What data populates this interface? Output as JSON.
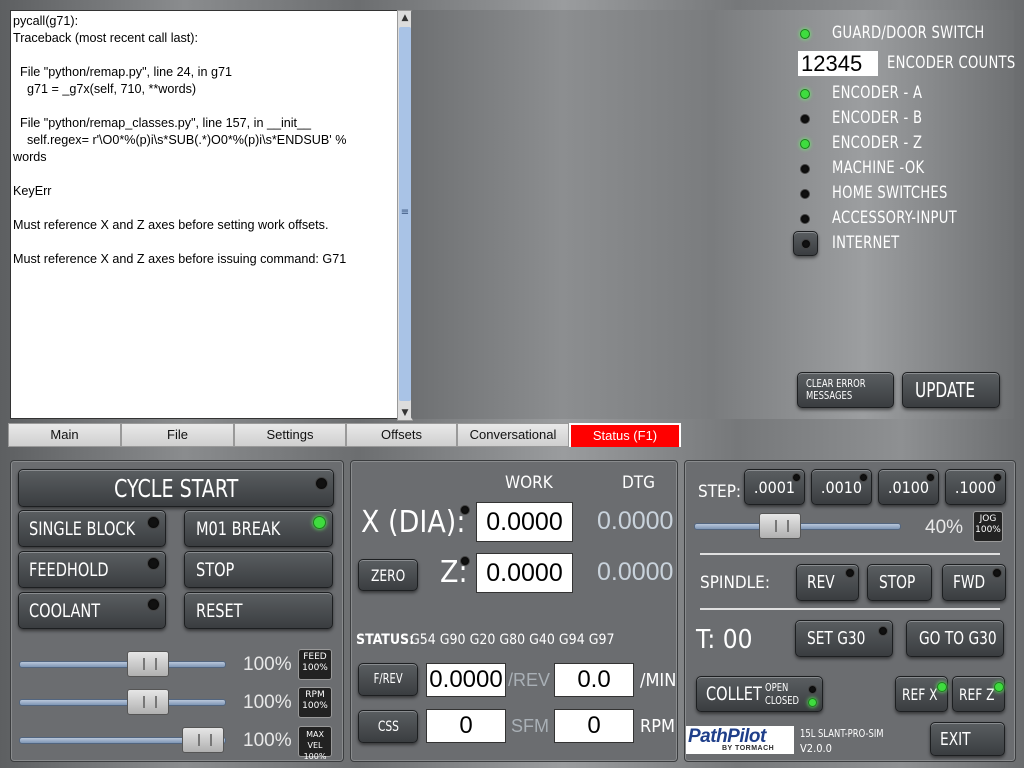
{
  "console": {
    "lines": [
      "pycall(g71):",
      "Traceback (most recent call last):",
      "",
      "  File \"python/remap.py\", line 24, in g71",
      "    g71 = _g7x(self, 710, **words)",
      "",
      "  File \"python/remap_classes.py\", line 157, in __init__",
      "    self.regex= r'\\O0*%(p)i\\s*SUB(.*)O0*%(p)i\\s*ENDSUB' %",
      "words",
      "",
      "KeyErr",
      "",
      "Must reference X and Z axes before setting work offsets.",
      "",
      "Must reference X and Z axes before issuing command: G71"
    ],
    "scroll_mid_glyph": "≡"
  },
  "status": {
    "guard_label": "GUARD/DOOR SWITCH",
    "encoder_counts_value": "12345",
    "encoder_counts_label": "ENCODER COUNTS",
    "encoder_a_label": "ENCODER - A",
    "encoder_b_label": "ENCODER - B",
    "encoder_z_label": "ENCODER - Z",
    "machine_ok_label": "MACHINE -OK",
    "home_switches_label": "HOME SWITCHES",
    "accessory_input_label": "ACCESSORY-INPUT",
    "internet_label": "INTERNET",
    "clear_error_line1": "CLEAR ERROR",
    "clear_error_line2": "MESSAGES",
    "update_label": "UPDATE"
  },
  "tabs": [
    "Main",
    "File",
    "Settings",
    "Offsets",
    "Conversational",
    "Status (F1)"
  ],
  "left_panel": {
    "cycle_start": "CYCLE START",
    "single_block": "SINGLE BLOCK",
    "m01_break": "M01 BREAK",
    "feedhold": "FEEDHOLD",
    "stop": "STOP",
    "coolant": "COOLANT",
    "reset": "RESET",
    "feed_pct": "100%",
    "feed_btn_l1": "FEED",
    "feed_btn_l2": "100%",
    "rpm_pct": "100%",
    "rpm_btn_l1": "RPM",
    "rpm_btn_l2": "100%",
    "maxvel_pct": "100%",
    "maxvel_btn_l1": "MAX VEL",
    "maxvel_btn_l2": "100%"
  },
  "dro": {
    "work_header": "WORK",
    "dtg_header": "DTG",
    "x_label": "X (DIA):",
    "x_work": "0.0000",
    "x_dtg": "0.0000",
    "zero_label": "ZERO",
    "z_label": "Z:",
    "z_work": "0.0000",
    "z_dtg": "0.0000",
    "status_label": "STATUS:",
    "status_codes": "G54 G90 G20 G80 G40 G94 G97",
    "frev_label": "F/REV",
    "feed_rev_value": "0.0000",
    "feed_rev_unit": "/REV",
    "feed_min_value": "0.0",
    "feed_min_unit": "/MIN",
    "css_label": "CSS",
    "sfm_value": "0",
    "sfm_unit": "SFM",
    "rpm_value": "0",
    "rpm_unit": "RPM"
  },
  "right_panel": {
    "step_label": "STEP:",
    "steps": [
      ".0001",
      ".0010",
      ".0100",
      ".1000"
    ],
    "jog_pct": "40%",
    "jog_btn_l1": "JOG",
    "jog_btn_l2": "100%",
    "spindle_label": "SPINDLE:",
    "rev": "REV",
    "stop": "STOP",
    "fwd": "FWD",
    "tool_label": "T: 00",
    "set_g30": "SET G30",
    "go_to_g30": "GO TO G30",
    "collet": "COLLET",
    "collet_open": "OPEN",
    "collet_closed": "CLOSED",
    "ref_x": "REF X",
    "ref_z": "REF Z",
    "logo_text": "PathPilot",
    "logo_sub": "BY TORMACH",
    "machine_name": "15L SLANT-PRO-SIM",
    "version": "V2.0.0",
    "exit": "EXIT"
  },
  "colors": {
    "active_tab": "#ff0000",
    "led_on": "#3fdc3f",
    "slider": "#7e96b5"
  }
}
